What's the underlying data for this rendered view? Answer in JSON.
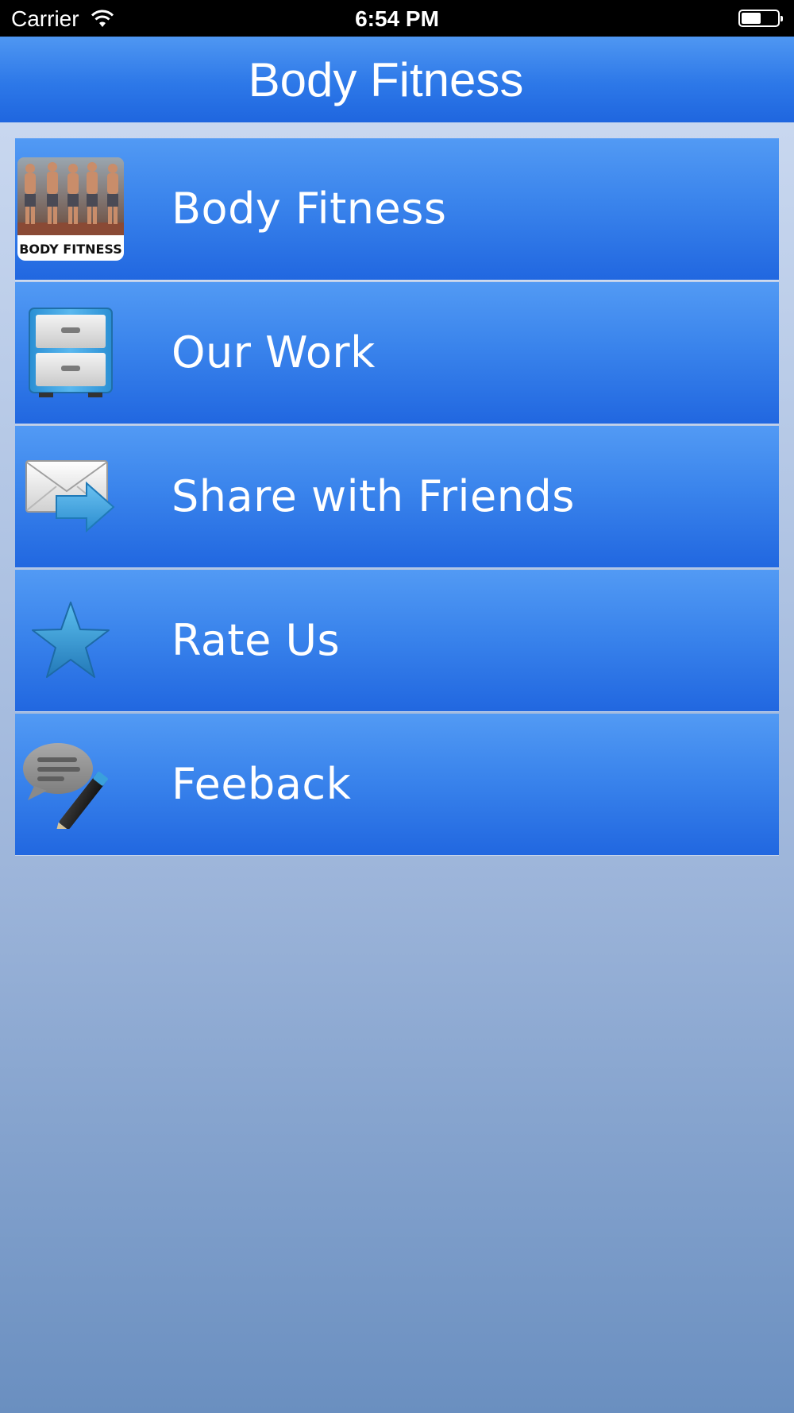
{
  "status_bar": {
    "carrier": "Carrier",
    "time": "6:54 PM",
    "battery_level": 0.55
  },
  "nav": {
    "title": "Body Fitness"
  },
  "menu": {
    "items": [
      {
        "label": "Body Fitness",
        "icon": "body-fitness-logo-icon",
        "logo_text": "BODY FITNESS"
      },
      {
        "label": "Our Work",
        "icon": "file-cabinet-icon"
      },
      {
        "label": "Share with Friends",
        "icon": "envelope-share-icon"
      },
      {
        "label": "Rate Us",
        "icon": "star-icon"
      },
      {
        "label": "Feeback",
        "icon": "chat-pencil-icon"
      }
    ]
  },
  "colors": {
    "nav_top": "#4f97f2",
    "nav_bottom": "#1f66df",
    "row_top": "#529af4",
    "row_bottom": "#2167e0",
    "background_bottom": "#6a8fc0"
  }
}
